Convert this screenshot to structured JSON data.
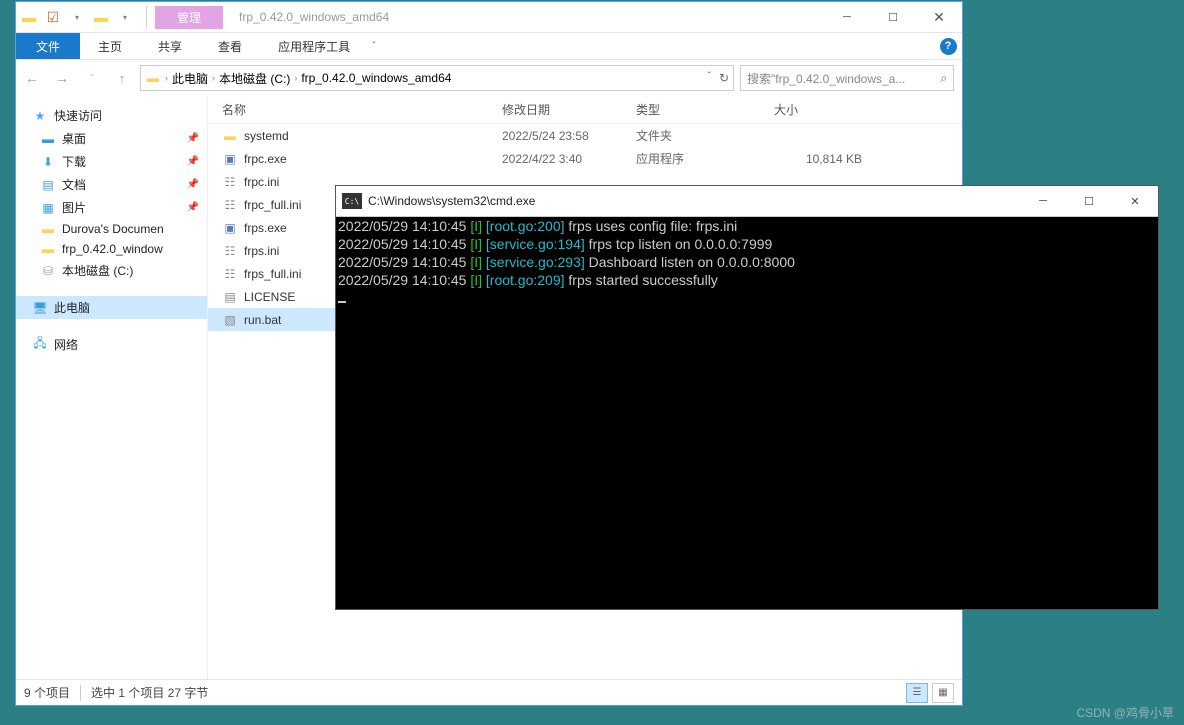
{
  "explorer": {
    "window_title": "frp_0.42.0_windows_amd64",
    "qat": {
      "checkbox": "☑"
    },
    "title_tab": "管理",
    "ribbon": {
      "file": "文件",
      "home": "主页",
      "share": "共享",
      "view": "查看",
      "apptools": "应用程序工具"
    },
    "nav": {
      "back": "←",
      "forward": "→",
      "up": "↑"
    },
    "breadcrumb": {
      "pc": "此电脑",
      "disk": "本地磁盘 (C:)",
      "folder": "frp_0.42.0_windows_amd64"
    },
    "search_placeholder": "搜索\"frp_0.42.0_windows_a...",
    "sidebar": {
      "quick": {
        "label": "快速访问"
      },
      "desktop": {
        "label": "桌面"
      },
      "downloads": {
        "label": "下载"
      },
      "documents": {
        "label": "文档"
      },
      "pictures": {
        "label": "图片"
      },
      "durova": {
        "label": "Durova's Documen"
      },
      "frp": {
        "label": "frp_0.42.0_window"
      },
      "c_disk": {
        "label": "本地磁盘 (C:)"
      },
      "thispc": {
        "label": "此电脑"
      },
      "network": {
        "label": "网络"
      }
    },
    "columns": {
      "name": "名称",
      "date": "修改日期",
      "type": "类型",
      "size": "大小"
    },
    "files": [
      {
        "icon": "folder",
        "name": "systemd",
        "date": "2022/5/24 23:58",
        "type": "文件夹",
        "size": ""
      },
      {
        "icon": "exe",
        "name": "frpc.exe",
        "date": "2022/4/22 3:40",
        "type": "应用程序",
        "size": "10,814 KB"
      },
      {
        "icon": "ini",
        "name": "frpc.ini",
        "date": "",
        "type": "",
        "size": ""
      },
      {
        "icon": "ini",
        "name": "frpc_full.ini",
        "date": "",
        "type": "",
        "size": ""
      },
      {
        "icon": "exe",
        "name": "frps.exe",
        "date": "",
        "type": "",
        "size": ""
      },
      {
        "icon": "ini",
        "name": "frps.ini",
        "date": "",
        "type": "",
        "size": ""
      },
      {
        "icon": "ini",
        "name": "frps_full.ini",
        "date": "",
        "type": "",
        "size": ""
      },
      {
        "icon": "txt",
        "name": "LICENSE",
        "date": "",
        "type": "",
        "size": ""
      },
      {
        "icon": "bat",
        "name": "run.bat",
        "date": "",
        "type": "",
        "size": "",
        "selected": true
      }
    ],
    "status": {
      "items": "9 个项目",
      "selection": "选中 1 个项目 27 字节"
    }
  },
  "cmd": {
    "title": "C:\\Windows\\system32\\cmd.exe",
    "lines": [
      {
        "ts": "2022/05/29 14:10:45 ",
        "lvl": "[I] ",
        "src": "[root.go:200] ",
        "msg": "frps uses config file: frps.ini"
      },
      {
        "ts": "2022/05/29 14:10:45 ",
        "lvl": "[I] ",
        "src": "[service.go:194] ",
        "msg": "frps tcp listen on 0.0.0.0:7999"
      },
      {
        "ts": "2022/05/29 14:10:45 ",
        "lvl": "[I] ",
        "src": "[service.go:293] ",
        "msg": "Dashboard listen on 0.0.0.0:8000"
      },
      {
        "ts": "2022/05/29 14:10:45 ",
        "lvl": "[I] ",
        "src": "[root.go:209] ",
        "msg": "frps started successfully"
      }
    ]
  },
  "watermark": "CSDN @鸡骨小草"
}
